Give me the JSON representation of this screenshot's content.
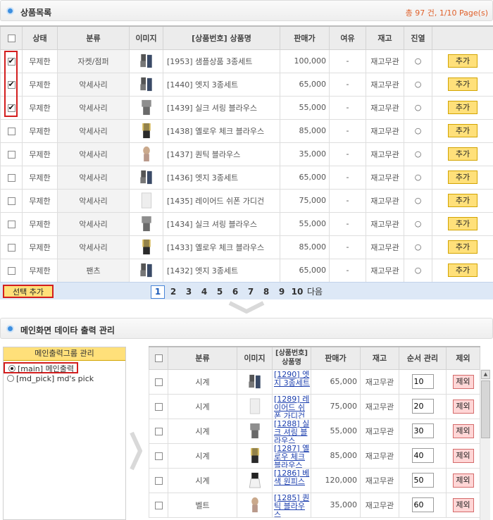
{
  "list_section": {
    "title": "상품목록",
    "summary": "총 97 건, 1/10 Page(s)",
    "columns": [
      "상태",
      "분류",
      "이미지",
      "[상품번호] 상품명",
      "판매가",
      "여유",
      "재고",
      "진열"
    ],
    "rows": [
      {
        "checked": true,
        "status": "무제한",
        "category": "자켓/점퍼",
        "name": "[1953] 샘플상품 3종세트",
        "price": "100,000",
        "spare": "-",
        "stock": "재고무관",
        "display": "○",
        "action": "추가"
      },
      {
        "checked": true,
        "status": "무제한",
        "category": "악세사리",
        "name": "[1440] 엣지 3종세트",
        "price": "65,000",
        "spare": "-",
        "stock": "재고무관",
        "display": "○",
        "action": "추가"
      },
      {
        "checked": true,
        "status": "무제한",
        "category": "악세사리",
        "name": "[1439] 실크 셔링 블라우스",
        "price": "55,000",
        "spare": "-",
        "stock": "재고무관",
        "display": "○",
        "action": "추가"
      },
      {
        "checked": false,
        "status": "무제한",
        "category": "악세사리",
        "name": "[1438] 옐로우 체크 블라우스",
        "price": "85,000",
        "spare": "-",
        "stock": "재고무관",
        "display": "○",
        "action": "추가"
      },
      {
        "checked": false,
        "status": "무제한",
        "category": "악세사리",
        "name": "[1437] 퀀틱 블라우스",
        "price": "35,000",
        "spare": "-",
        "stock": "재고무관",
        "display": "○",
        "action": "추가"
      },
      {
        "checked": false,
        "status": "무제한",
        "category": "악세사리",
        "name": "[1436] 엣지 3종세트",
        "price": "65,000",
        "spare": "-",
        "stock": "재고무관",
        "display": "○",
        "action": "추가"
      },
      {
        "checked": false,
        "status": "무제한",
        "category": "악세사리",
        "name": "[1435] 레이어드 쉬폰 가디건",
        "price": "75,000",
        "spare": "-",
        "stock": "재고무관",
        "display": "○",
        "action": "추가"
      },
      {
        "checked": false,
        "status": "무제한",
        "category": "악세사리",
        "name": "[1434] 실크 셔링 블라우스",
        "price": "55,000",
        "spare": "-",
        "stock": "재고무관",
        "display": "○",
        "action": "추가"
      },
      {
        "checked": false,
        "status": "무제한",
        "category": "악세사리",
        "name": "[1433] 옐로우 체크 블라우스",
        "price": "85,000",
        "spare": "-",
        "stock": "재고무관",
        "display": "○",
        "action": "추가"
      },
      {
        "checked": false,
        "status": "무제한",
        "category": "팬츠",
        "name": "[1432] 엣지 3종세트",
        "price": "65,000",
        "spare": "-",
        "stock": "재고무관",
        "display": "○",
        "action": "추가"
      }
    ],
    "select_add_label": "선택 추가",
    "pages": [
      "1",
      "2",
      "3",
      "4",
      "5",
      "6",
      "7",
      "8",
      "9",
      "10"
    ],
    "current_page": "1",
    "next_label": "다음"
  },
  "main_section": {
    "title": "메인화면 데이타 출력 관리",
    "group_panel": {
      "title": "메인출력그룹 관리",
      "options": [
        {
          "label": "[main] 메인출력",
          "selected": true
        },
        {
          "label": "[md_pick] md's pick",
          "selected": false
        }
      ]
    },
    "columns": [
      "분류",
      "이미지",
      "[상품번호] 상품명",
      "판매가",
      "재고",
      "순서 관리",
      "제외"
    ],
    "rows": [
      {
        "category": "시계",
        "name": "[1290] 엣지 3종세트",
        "price": "65,000",
        "stock": "재고무관",
        "order": "10",
        "exclude": "제외"
      },
      {
        "category": "시계",
        "name": "[1289] 레이어드 쉬폰 가디건",
        "price": "75,000",
        "stock": "재고무관",
        "order": "20",
        "exclude": "제외"
      },
      {
        "category": "시계",
        "name": "[1288] 실크 셔링 블라우스",
        "price": "55,000",
        "stock": "재고무관",
        "order": "30",
        "exclude": "제외"
      },
      {
        "category": "시계",
        "name": "[1287] 옐로우 체크 블라우스",
        "price": "85,000",
        "stock": "재고무관",
        "order": "40",
        "exclude": "제외"
      },
      {
        "category": "시계",
        "name": "[1286] 베색 원피스",
        "price": "120,000",
        "stock": "재고무관",
        "order": "50",
        "exclude": "제외"
      },
      {
        "category": "벨트",
        "name": "[1285] 퀀틱 블라우스",
        "price": "35,000",
        "stock": "재고무관",
        "order": "60",
        "exclude": "제외"
      }
    ]
  },
  "colors": {
    "accent_blue": "#1c3fae",
    "summary_orange": "#e0602a",
    "button_yellow": "#ffe07a",
    "exclude_pink": "#ffd6d6",
    "highlight_red": "#d31e1e"
  }
}
